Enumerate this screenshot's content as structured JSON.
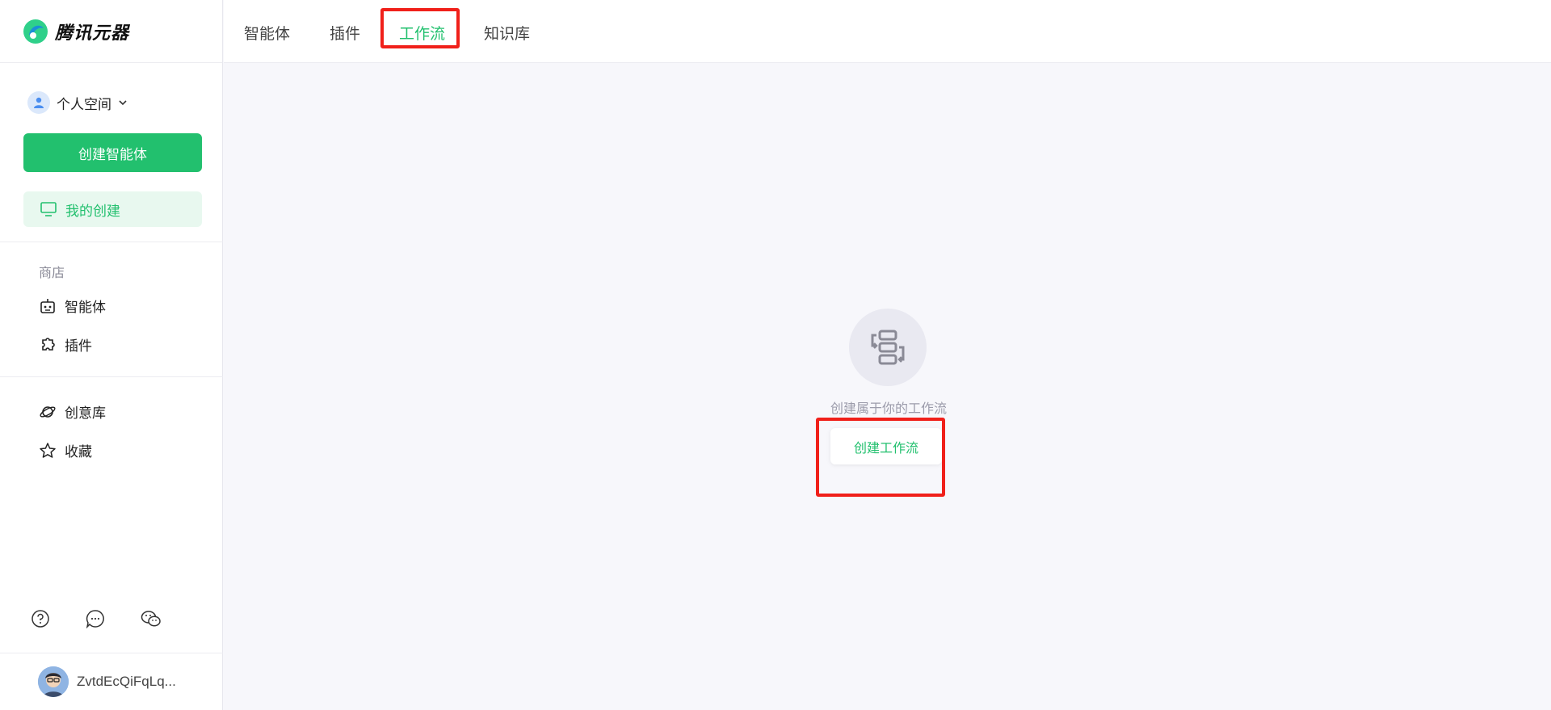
{
  "brand": {
    "name": "腾讯元器",
    "logo_icon": "yuanqi-logo-icon"
  },
  "sidebar": {
    "space_label": "个人空间",
    "create_agent_label": "创建智能体",
    "my_creation_label": "我的创建",
    "store_section_title": "商店",
    "store_items": [
      {
        "label": "智能体",
        "icon": "robot-icon"
      },
      {
        "label": "插件",
        "icon": "puzzle-icon"
      }
    ],
    "other_items": [
      {
        "label": "创意库",
        "icon": "planet-icon"
      },
      {
        "label": "收藏",
        "icon": "star-icon"
      }
    ],
    "bottom_icons": [
      "help-icon",
      "feedback-icon",
      "wechat-icon"
    ],
    "user_name": "ZvtdEcQiFqLq..."
  },
  "topbar": {
    "tabs": [
      {
        "label": "智能体",
        "active": false
      },
      {
        "label": "插件",
        "active": false
      },
      {
        "label": "工作流",
        "active": true
      },
      {
        "label": "知识库",
        "active": false
      }
    ]
  },
  "main": {
    "empty_icon": "workflow-icon",
    "empty_text": "创建属于你的工作流",
    "create_workflow_label": "创建工作流"
  },
  "colors": {
    "accent": "#22c06e",
    "highlight": "#f0201a",
    "background": "#f7f7fb"
  }
}
